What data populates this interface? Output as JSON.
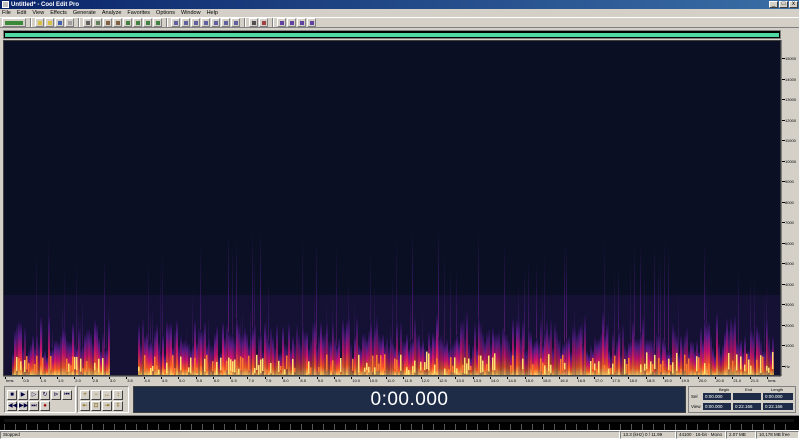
{
  "window": {
    "title": "Untitled* - Cool Edit Pro"
  },
  "menu": [
    "File",
    "Edit",
    "View",
    "Effects",
    "Generate",
    "Analyze",
    "Favorites",
    "Options",
    "Window",
    "Help"
  ],
  "time_display": "0:00.000",
  "selection_panel": {
    "col_headers": [
      "Begin",
      "End",
      "Length"
    ],
    "rows": [
      {
        "label": "Sel",
        "begin": "0:00.000",
        "end": "",
        "length": "0:00.000"
      },
      {
        "label": "View",
        "begin": "0:00.000",
        "end": "0:22.166",
        "length": "0:22.166"
      }
    ]
  },
  "status": {
    "state": "Stopped",
    "sample": "13.3 (kHz) 0 / 11.99",
    "format": "44100 · 16-bit · Mono",
    "size": "2.07 MB",
    "free": "10,178 MB free"
  },
  "vruler_labels": [
    "15000",
    "14000",
    "13000",
    "12000",
    "11000",
    "10000",
    "9000",
    "8000",
    "7000",
    "6000",
    "5000",
    "4000",
    "3000",
    "2000",
    "1000",
    "Hz"
  ],
  "hruler_labels": [
    "hms",
    "0.5",
    "1.0",
    "1.5",
    "2.0",
    "2.5",
    "3.0",
    "3.5",
    "4.0",
    "4.5",
    "5.0",
    "5.5",
    "6.0",
    "6.5",
    "7.0",
    "7.5",
    "8.0",
    "8.5",
    "9.0",
    "9.5",
    "10.0",
    "10.5",
    "11.0",
    "11.5",
    "12.0",
    "12.5",
    "13.0",
    "13.5",
    "14.0",
    "14.5",
    "15.0",
    "15.5",
    "16.0",
    "16.5",
    "17.0",
    "17.5",
    "18.0",
    "18.5",
    "19.0",
    "19.5",
    "20.0",
    "20.5",
    "21.0",
    "21.5",
    "hms"
  ],
  "colors": {
    "spectrogram_bg": "#0a0f24",
    "overview_range": "#4fd8a4",
    "time_display_bg": "#1e2c48"
  }
}
